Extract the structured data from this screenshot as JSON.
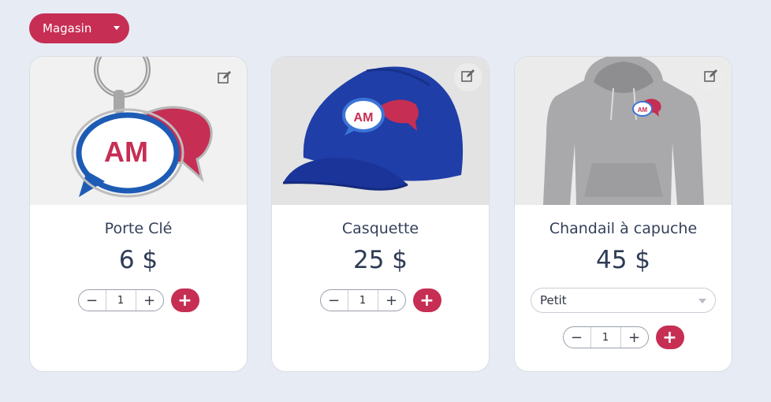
{
  "store_menu": {
    "label": "Magasin"
  },
  "products": [
    {
      "title": "Porte Clé",
      "price": "6 $",
      "quantity": "1",
      "decrease": "−",
      "increase": "+",
      "add": "+"
    },
    {
      "title": "Casquette",
      "price": "25 $",
      "quantity": "1",
      "decrease": "−",
      "increase": "+",
      "add": "+"
    },
    {
      "title": "Chandail à capuche",
      "price": "45 $",
      "size": "Petit",
      "quantity": "1",
      "decrease": "−",
      "increase": "+",
      "add": "+"
    }
  ],
  "logo_text": "AM",
  "colors": {
    "accent": "#c62e54",
    "logo_blue": "#1d5bb5",
    "cap_blue": "#1f3ea8",
    "hoodie_gray": "#a9a9ab"
  }
}
